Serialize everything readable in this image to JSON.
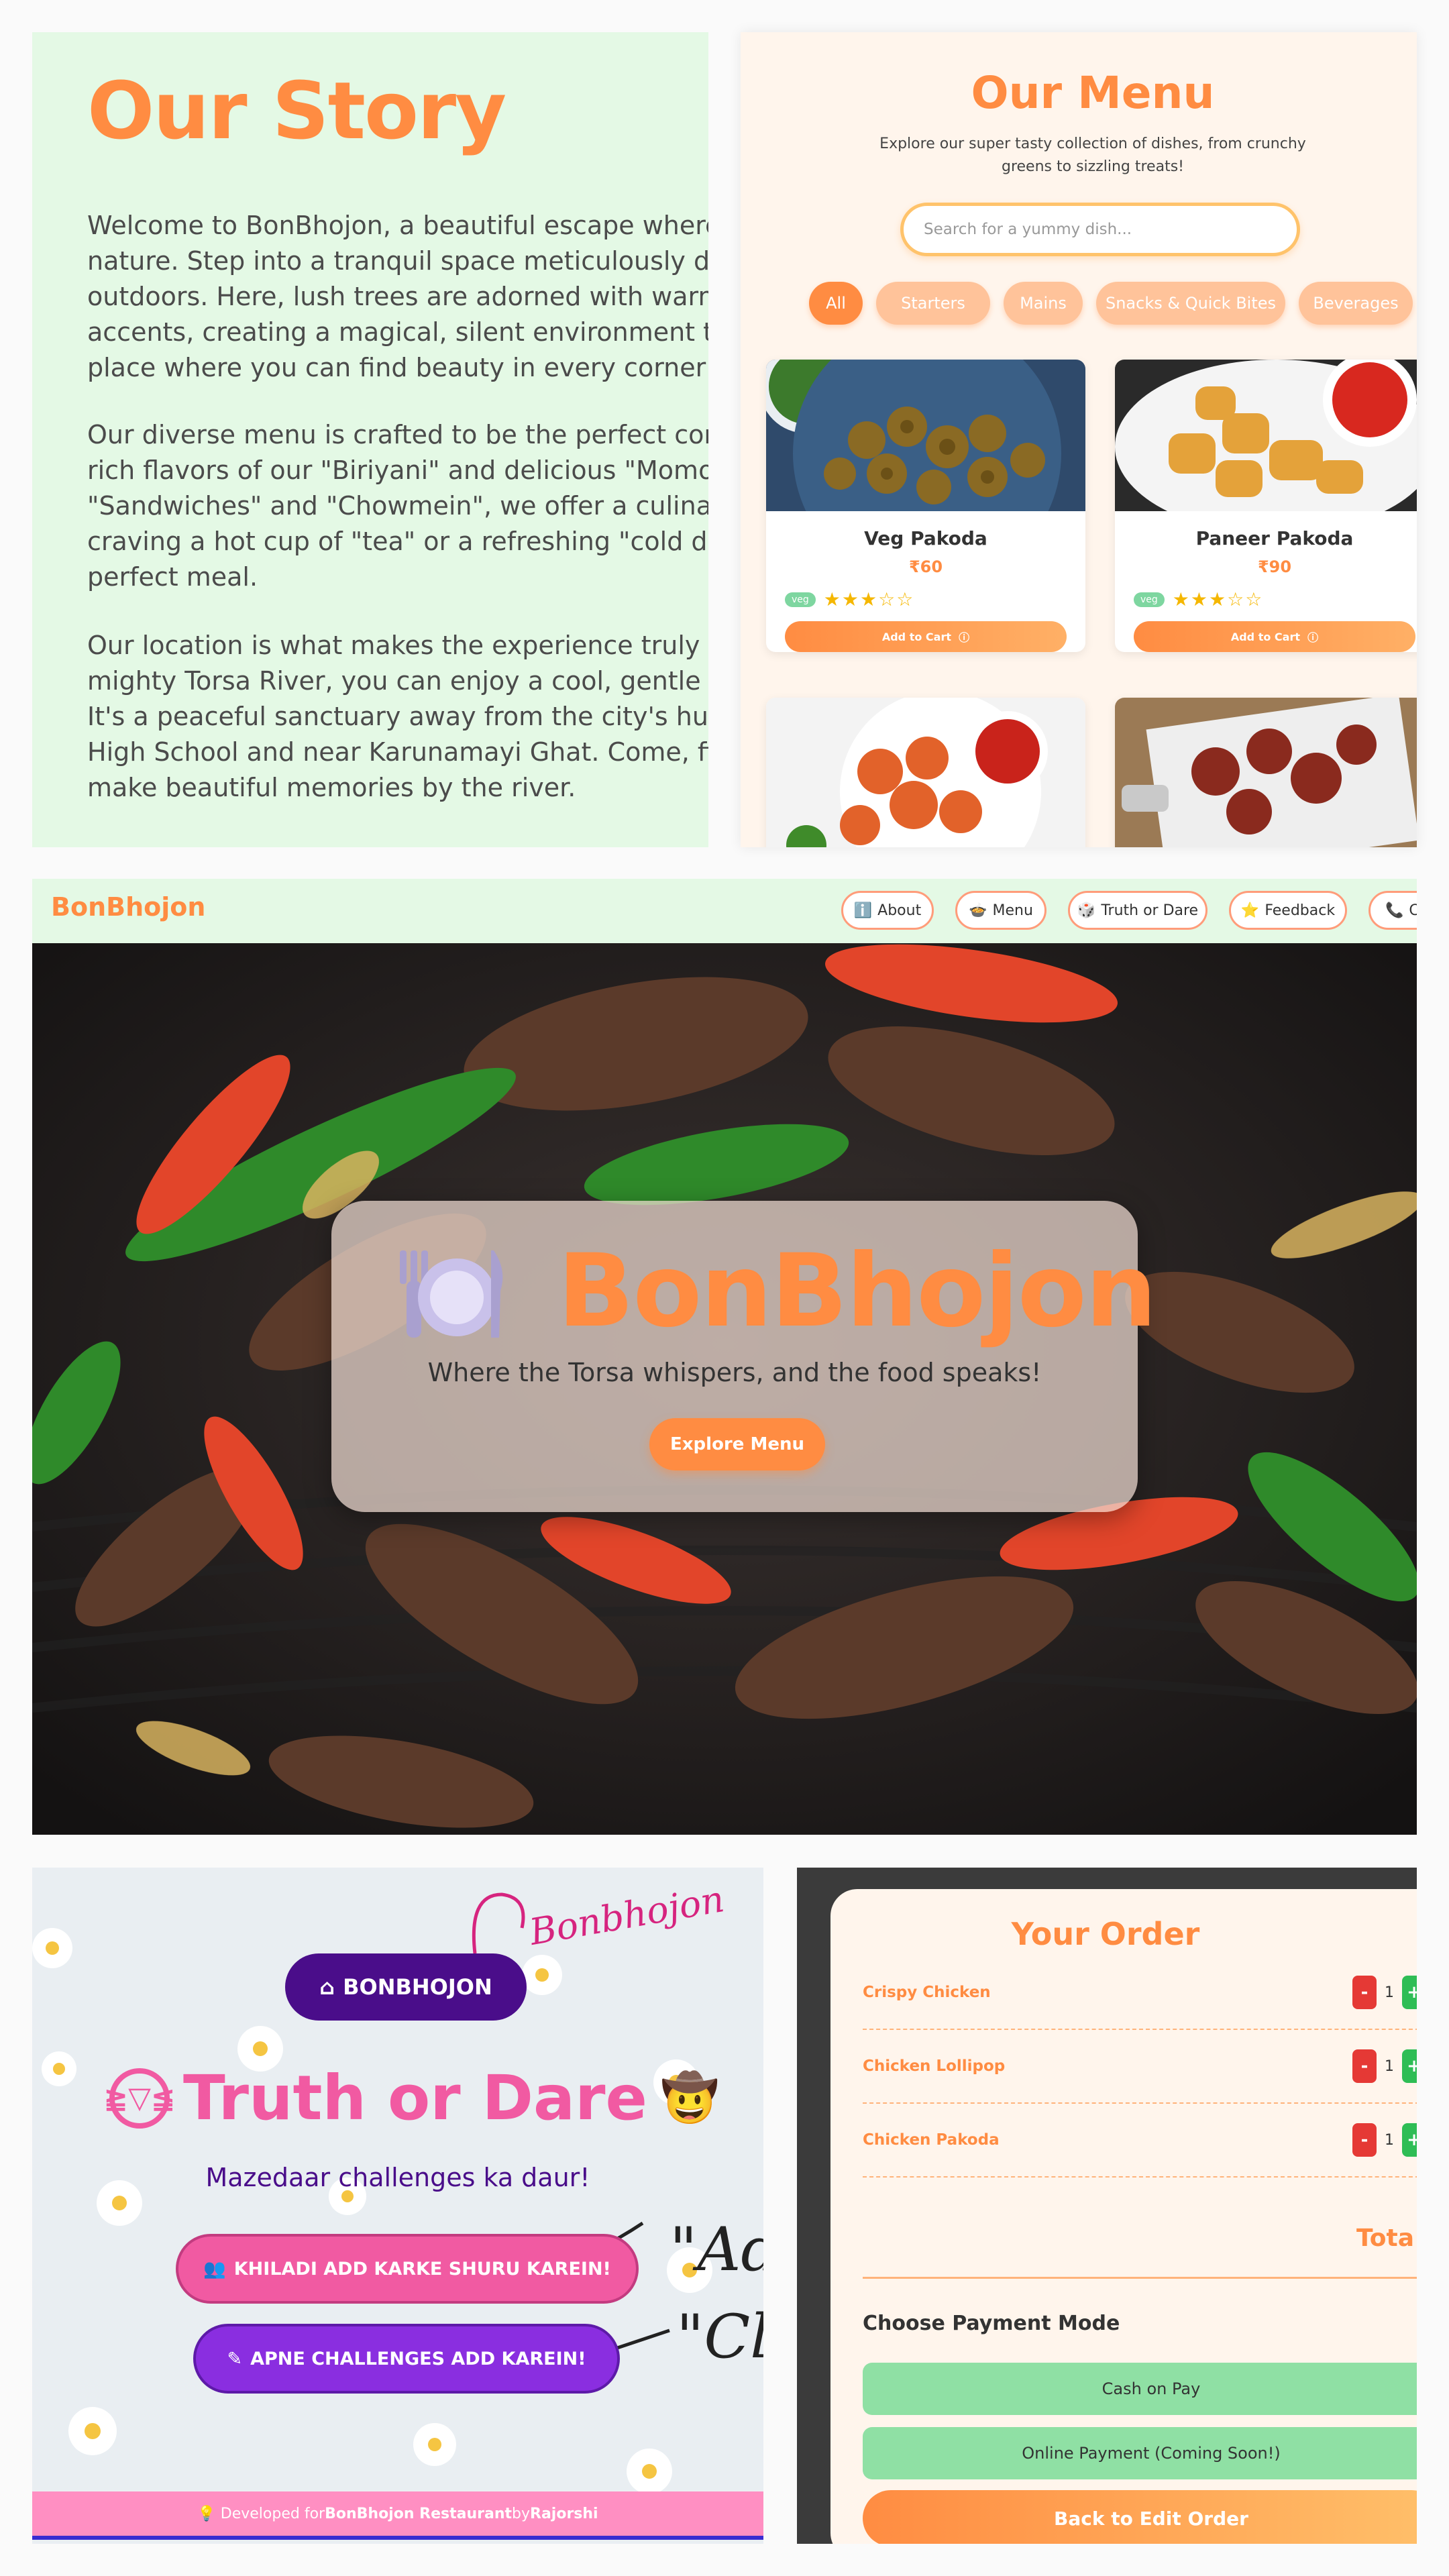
{
  "story": {
    "title": "Our Story",
    "paragraphs": [
      "Welcome to BonBhojon, a beautiful escape where a lo of nature. Step into a tranquil space meticulously deco outdoors. Here, lush trees are adorned with warm, gen accents, creating a magical, silent environment that fe place where you can find beauty in every corner and a",
      "Our diverse menu is crafted to be the perfect compani rich flavors of our \"Biriyani\" and delicious \"Momos\" to \"Sandwiches\" and \"Chowmein\", we offer a culinary jour craving a hot cup of \"tea\" or a refreshing \"cold drink\", perfect meal.",
      "Our location is what makes the experience truly speci mighty Torsa River, you can enjoy a cool, gentle breeze It's a peaceful sanctuary away from the city's hustle, jus High School and near Karunamayi Ghat. Come, find you make beautiful memories by the river."
    ]
  },
  "menu": {
    "title": "Our Menu",
    "subtitle": "Explore our super tasty collection of dishes, from crunchy greens to sizzling treats!",
    "search_placeholder": "Search for a yummy dish...",
    "categories": [
      "All",
      "Starters",
      "Mains",
      "Snacks & Quick Bites",
      "Beverages"
    ],
    "items": [
      {
        "name": "Veg Pakoda",
        "price": "₹60",
        "badge": "veg",
        "stars": "★★★☆☆",
        "button": "Add to Cart"
      },
      {
        "name": "Paneer Pakoda",
        "price": "₹90",
        "badge": "veg",
        "stars": "★★★☆☆",
        "button": "Add to Cart"
      }
    ]
  },
  "hero": {
    "brand": "BonBhojon",
    "nav": [
      "About",
      "Menu",
      "Truth or Dare",
      "Feedback",
      "C"
    ],
    "nav_icons": [
      "ℹ️",
      "🍲",
      "🎲",
      "⭐",
      "📞"
    ],
    "title": "BonBhojon",
    "tagline": "Where the Torsa whispers, and the food speaks!",
    "cta": "Explore Menu"
  },
  "tod": {
    "home_button": "BONBHOJON",
    "title": "Truth or Dare",
    "subtitle": "Mazedaar challenges ka daur!",
    "button1": "KHILADI ADD KARKE SHURU KAREIN!",
    "button2": "APNE CHALLENGES ADD KAREIN!",
    "footer_prefix": "💡 Developed for ",
    "footer_brand": "BonBhojon Restaurant",
    "footer_by": " by ",
    "footer_author": "Rajorshi",
    "hand_note": "Bonbhojon"
  },
  "order": {
    "title": "Your Order",
    "items": [
      {
        "name": "Crispy Chicken",
        "qty": "1"
      },
      {
        "name": "Chicken Lollipop",
        "qty": "1"
      },
      {
        "name": "Chicken Pakoda",
        "qty": "1"
      }
    ],
    "total_label": "Tota",
    "payment_heading": "Choose Payment Mode",
    "payment_options": [
      "Cash on Pay",
      "Online Payment (Coming Soon!)"
    ],
    "back_button": "Back to Edit Order"
  },
  "colors": {
    "accent": "#ff8c42",
    "mint": "#e4f9e5",
    "pink": "#f15aa2",
    "purple": "#4a0d8a"
  }
}
